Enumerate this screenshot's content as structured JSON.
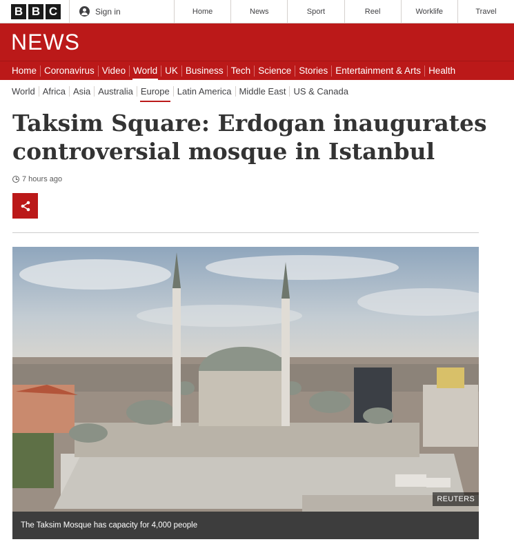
{
  "top": {
    "logo_letters": [
      "B",
      "B",
      "C"
    ],
    "signin_label": "Sign in",
    "nav": [
      "Home",
      "News",
      "Sport",
      "Reel",
      "Worklife",
      "Travel"
    ]
  },
  "banner": {
    "title": "NEWS"
  },
  "sections": {
    "items": [
      "Home",
      "Coronavirus",
      "Video",
      "World",
      "UK",
      "Business",
      "Tech",
      "Science",
      "Stories",
      "Entertainment & Arts",
      "Health"
    ],
    "active": "World"
  },
  "subsections": {
    "items": [
      "World",
      "Africa",
      "Asia",
      "Australia",
      "Europe",
      "Latin America",
      "Middle East",
      "US & Canada"
    ],
    "active": "Europe"
  },
  "article": {
    "headline": "Taksim Square: Erdogan inaugurates controversial mosque in Istanbul",
    "timestamp": "7 hours ago",
    "share_icon": "share-icon",
    "image_credit": "REUTERS",
    "image_caption": "The Taksim Mosque has capacity for 4,000 people"
  },
  "colors": {
    "brand_red": "#bb1919"
  }
}
